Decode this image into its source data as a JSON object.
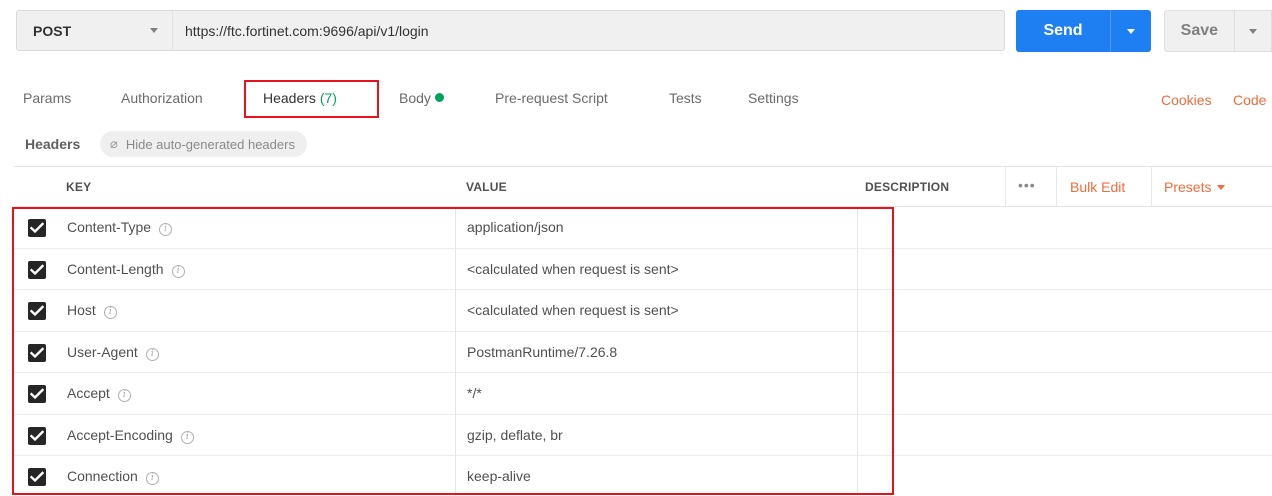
{
  "request": {
    "method": "POST",
    "url": "https://ftc.fortinet.com:9696/api/v1/login",
    "send_label": "Send",
    "save_label": "Save"
  },
  "tabs": [
    {
      "label": "Params"
    },
    {
      "label": "Authorization"
    },
    {
      "label": "Headers",
      "count": "(7)"
    },
    {
      "label": "Body"
    },
    {
      "label": "Pre-request Script"
    },
    {
      "label": "Tests"
    },
    {
      "label": "Settings"
    }
  ],
  "links": {
    "cookies": "Cookies",
    "code": "Code"
  },
  "headers_section": {
    "title": "Headers",
    "hide_label": "Hide auto-generated headers"
  },
  "table": {
    "columns": {
      "key": "KEY",
      "value": "VALUE",
      "description": "DESCRIPTION"
    },
    "more": "•••",
    "bulk_edit": "Bulk Edit",
    "presets": "Presets",
    "rows": [
      {
        "key": "Content-Type",
        "value": "application/json",
        "checked": true
      },
      {
        "key": "Content-Length",
        "value": "<calculated when request is sent>",
        "checked": true
      },
      {
        "key": "Host",
        "value": "<calculated when request is sent>",
        "checked": true
      },
      {
        "key": "User-Agent",
        "value": "PostmanRuntime/7.26.8",
        "checked": true
      },
      {
        "key": "Accept",
        "value": "*/*",
        "checked": true
      },
      {
        "key": "Accept-Encoding",
        "value": "gzip, deflate, br",
        "checked": true
      },
      {
        "key": "Connection",
        "value": "keep-alive",
        "checked": true
      }
    ]
  },
  "colors": {
    "send": "#1d7ff2",
    "accent_orange": "#f26b3a",
    "green": "#00a35a",
    "highlight": "#e8121c"
  }
}
